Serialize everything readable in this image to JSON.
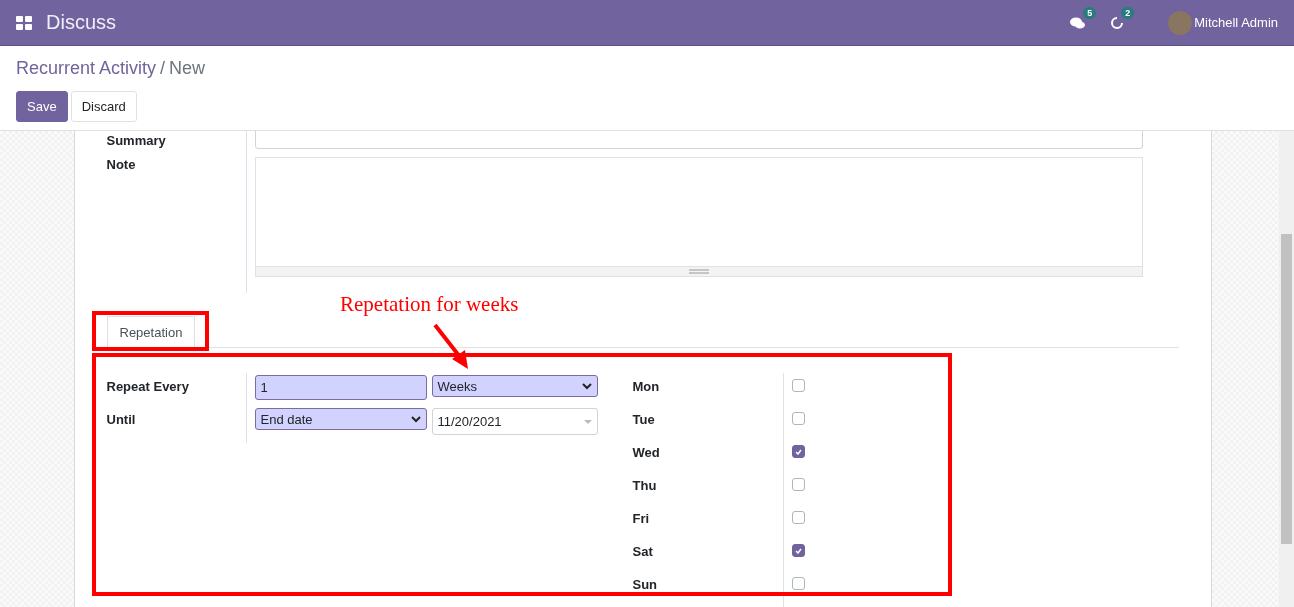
{
  "navbar": {
    "app_title": "Discuss",
    "messages_badge": "5",
    "activities_badge": "2",
    "user_name": "Mitchell Admin"
  },
  "breadcrumb": {
    "parent": "Recurrent Activity",
    "separator": "/",
    "current": "New"
  },
  "buttons": [
    {
      "label": "Save",
      "kind": "primary"
    },
    {
      "label": "Discard",
      "kind": "secondary"
    }
  ],
  "form": {
    "summary_label": "Summary",
    "note_label": "Note"
  },
  "tabs": [
    {
      "label": "Repetation",
      "selected": true
    }
  ],
  "repetition": {
    "repeat_every_label": "Repeat Every",
    "interval": "1",
    "unit": "Weeks",
    "until_label": "Until",
    "until_type": "End date",
    "until_date": "11/20/2021",
    "days": [
      {
        "label": "Mon",
        "checked": false
      },
      {
        "label": "Tue",
        "checked": false
      },
      {
        "label": "Wed",
        "checked": true
      },
      {
        "label": "Thu",
        "checked": false
      },
      {
        "label": "Fri",
        "checked": false
      },
      {
        "label": "Sat",
        "checked": true
      },
      {
        "label": "Sun",
        "checked": false
      }
    ]
  },
  "annotation": {
    "text": "Repetation for weeks"
  }
}
